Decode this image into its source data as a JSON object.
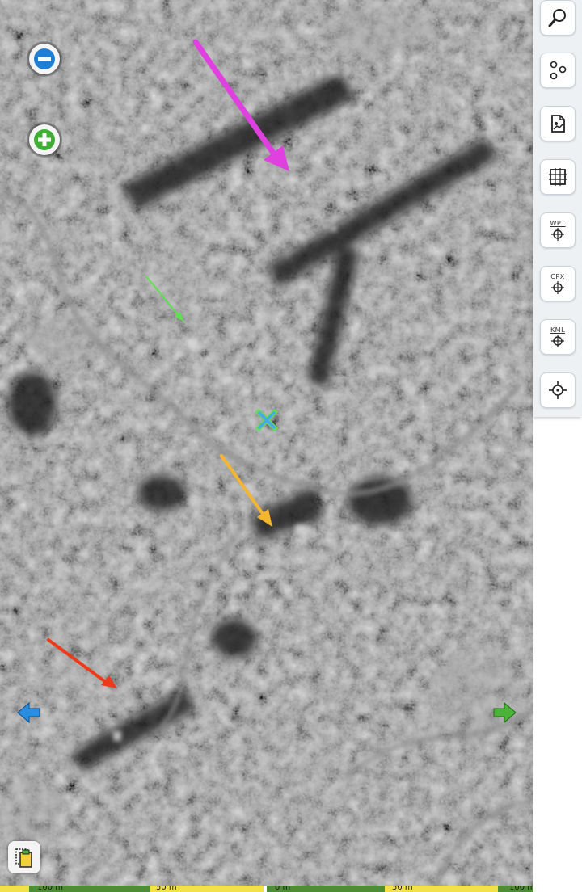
{
  "map": {
    "zoom_out_label": "−",
    "zoom_in_label": "+",
    "annotation_colors": {
      "magenta": "#e040e0",
      "green": "#5fe050",
      "yellow": "#f6b52e",
      "red": "#ee3a1a"
    },
    "center_marker_color": "#4aa8e6",
    "pan_left_color": "#2a8ee0",
    "pan_right_color": "#4cb33a"
  },
  "toolbar": {
    "items": [
      {
        "name": "search-tool",
        "icon": "magnifier-icon",
        "text": ""
      },
      {
        "name": "waypoints-tool",
        "icon": "nodes-icon",
        "text": ""
      },
      {
        "name": "document-tool",
        "icon": "document-icon",
        "text": ""
      },
      {
        "name": "grid-tool",
        "icon": "grid-icon",
        "text": ""
      },
      {
        "name": "wpt-tool",
        "icon": "crosshair-icon",
        "text": "WPT"
      },
      {
        "name": "cpx-tool",
        "icon": "crosshair-icon",
        "text": "CPX"
      },
      {
        "name": "kml-tool",
        "icon": "crosshair-icon",
        "text": "KML"
      },
      {
        "name": "locate-tool",
        "icon": "target-icon",
        "text": ""
      }
    ]
  },
  "scale_bar": {
    "labels": [
      "100 m",
      "50 m",
      "0 m",
      "50 m",
      "100 m"
    ],
    "colors": {
      "green": "#4f8d34",
      "yellow": "#f2e24a",
      "white": "#ffffff"
    }
  }
}
